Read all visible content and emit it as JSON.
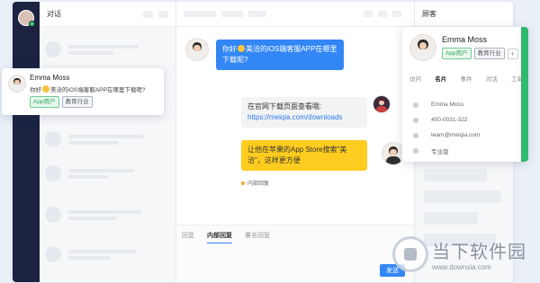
{
  "conversations": {
    "title": "对话"
  },
  "messages": [
    {
      "type": "incoming",
      "text_before": "你好",
      "text_after": "美洽的iOS端客服APP在哪里下载呢?"
    },
    {
      "type": "outgoing",
      "line1": "在官网下载页面查看哦:",
      "link": "https://meiqia.com/downloads"
    },
    {
      "type": "outgoing-note",
      "text": "让他在苹果的App Store搜索\"美洽\"，这样更方便",
      "note_label": "内部回复"
    }
  ],
  "compose": {
    "tabs": [
      "回复",
      "内部回复",
      "署名回复"
    ],
    "active_tab": "内部回复",
    "send_label": "发送"
  },
  "customer_panel": {
    "title": "顾客"
  },
  "profile": {
    "name": "Emma Moss",
    "tags": [
      "App用户",
      "教育行业"
    ],
    "add_tag": "+",
    "tabs": [
      "访问",
      "名片",
      "事件",
      "对话",
      "工单"
    ],
    "active_tab": "名片",
    "fields": {
      "name": "Emma Moss",
      "phone": "400-0031-322",
      "email": "team@meiqia.com",
      "role": "专业版"
    }
  },
  "floating_card": {
    "name": "Emma Moss",
    "message_before": "你好",
    "message_after": "美洽的iOS端客服APP在哪里下载呢?",
    "tags": [
      "App用户",
      "教育行业"
    ]
  },
  "watermark": {
    "title": "当下软件园",
    "url": "www.downxia.com"
  },
  "colors": {
    "rail": "#1b2341",
    "primary": "#3387f5",
    "note": "#ffcc1f",
    "accent_green": "#2fba6d"
  },
  "icons": {
    "user": "user-icon",
    "phone": "phone-icon",
    "email": "mail-icon",
    "tag": "tag-icon",
    "emoji": "smile-emoji-icon"
  }
}
